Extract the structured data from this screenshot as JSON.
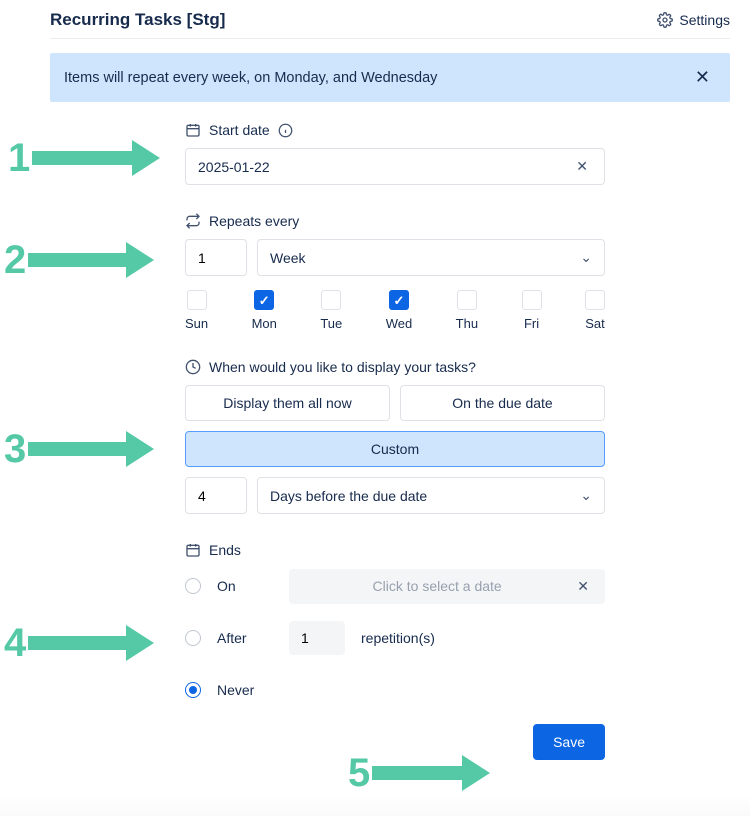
{
  "header": {
    "title": "Recurring Tasks [Stg]",
    "settings_label": "Settings"
  },
  "banner": {
    "text": "Items will repeat every week, on Monday, and Wednesday"
  },
  "start_date": {
    "label": "Start date",
    "value": "2025-01-22"
  },
  "repeats": {
    "label": "Repeats every",
    "count": "1",
    "unit": "Week",
    "days": [
      {
        "abbr": "Sun",
        "checked": false
      },
      {
        "abbr": "Mon",
        "checked": true
      },
      {
        "abbr": "Tue",
        "checked": false
      },
      {
        "abbr": "Wed",
        "checked": true
      },
      {
        "abbr": "Thu",
        "checked": false
      },
      {
        "abbr": "Fri",
        "checked": false
      },
      {
        "abbr": "Sat",
        "checked": false
      }
    ]
  },
  "display": {
    "label": "When would you like to display your tasks?",
    "opt_all": "Display them all now",
    "opt_due": "On the due date",
    "opt_custom": "Custom",
    "custom_count": "4",
    "custom_unit": "Days before the due date"
  },
  "ends": {
    "label": "Ends",
    "on_label": "On",
    "on_placeholder": "Click to select a date",
    "after_label": "After",
    "after_count": "1",
    "after_suffix": "repetition(s)",
    "never_label": "Never",
    "selected": "never"
  },
  "save_label": "Save",
  "annotations": {
    "n1": "1",
    "n2": "2",
    "n3": "3",
    "n4": "4",
    "n5": "5"
  }
}
